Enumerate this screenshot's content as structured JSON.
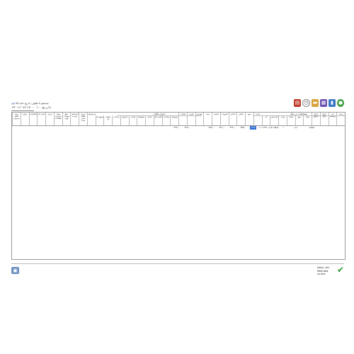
{
  "toolbar": {
    "icons": [
      "pdf-icon",
      "clock-icon",
      "folder-icon",
      "print-icon",
      "chart-icon",
      "go-icon"
    ],
    "info_prefix": "جستجو تا اطوار / تاریخ نامه ۵۷",
    "info_link": "کوه",
    "date_label": "تاریخ",
    "date_value": "۱۴۰۱/۰۷/۱۷ - ۱۰"
  },
  "grid": {
    "group_left": "جدول مالیات",
    "group_right": "مشخصات در سال",
    "headers_left": [
      "ردیف اقلام مصرفی",
      "میزان",
      "کاملکردی",
      "کسر کار",
      "ارزش",
      "بهای کسرکرد اطلاعات",
      "مبلغ تعهدات اولیه",
      "فرسایش بودجه",
      "ارزش اقلام کسر شده",
      "فرسودگی",
      "حقوق کار",
      "اضافه کار",
      "پرداخت",
      "دستمزد",
      "قیمت",
      "متوسط",
      "تعدیل",
      "قیمت کل",
      "پرداخت",
      "موجودی",
      "مالیات",
      "هزینه",
      "عوارض",
      "بیمه",
      "تخفیف",
      "کسورات",
      "کارکرد",
      "خالص",
      "جمع",
      "مانده"
    ],
    "headers_right": [
      "کد",
      "نام جنس",
      "واحد",
      "تعداد",
      "نوع",
      "سال",
      "تاریخ شروع",
      "تاریخ پایان",
      "کد پرسنلی",
      "ردیف"
    ],
    "row": {
      "name": "اسلحه",
      "unit": "عدد",
      "count": "۱",
      "date1": "۰۰/۱۰/۱۳۹۳",
      "date2": "۱۳۹۳/۰۵/۰۳",
      "v1": "۳۲۲/۰۰",
      "v2": "۳۲۲/۰۰",
      "v3": "۲۵۶/۰۰",
      "v4": "۴۵۰/۰۰",
      "v5": "۳۲۲/۰۰",
      "v6": "۴۷۵/۰۰",
      "sel": "۱۳۹۳",
      "label": "اسلحه ثابت"
    }
  },
  "footer": {
    "label": "Saba. Ltd.",
    "sub": "Mehrdad su.dev",
    "ok_icon": "check-icon"
  }
}
